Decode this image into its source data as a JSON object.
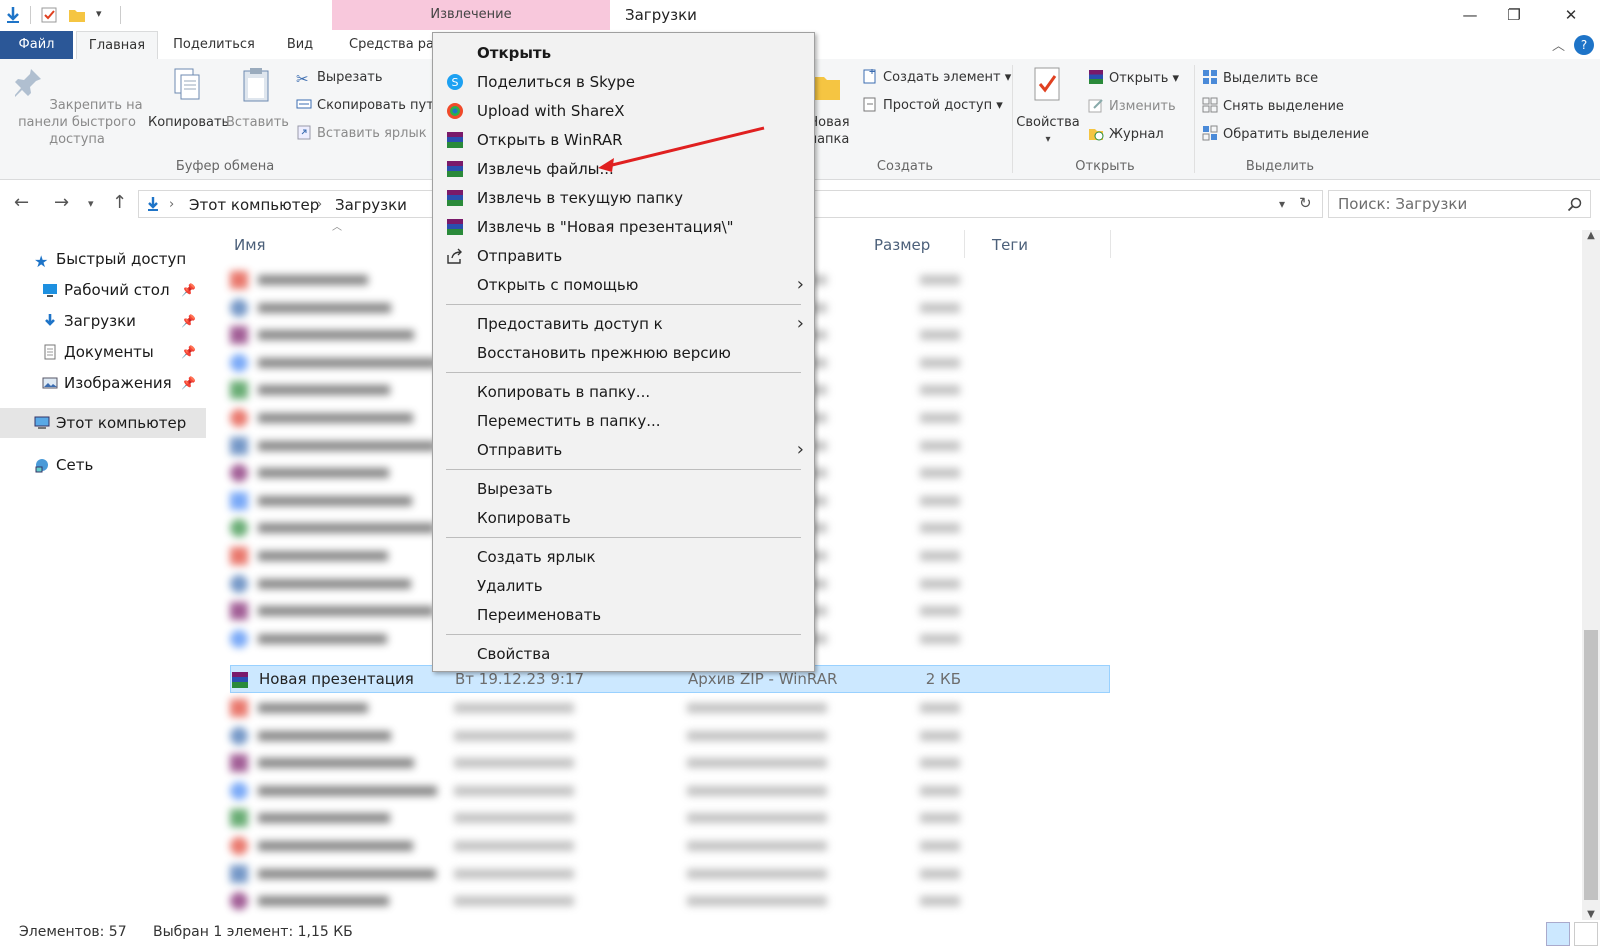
{
  "window": {
    "context_tab_label": "Извлечение",
    "title": "Загрузки",
    "minimize": "—",
    "restore": "❐",
    "close": "✕"
  },
  "ribbon_tabs": {
    "file": "Файл",
    "home": "Главная",
    "share": "Поделиться",
    "view": "Вид",
    "tools": "Средства раб"
  },
  "ribbon": {
    "pin_label": "Закрепить на панели быстрого доступа",
    "copy_label": "Копировать",
    "paste_label": "Вставить",
    "cut_label": "Вырезать",
    "copy_path_label": "Скопировать путь",
    "paste_shortcut_label": "Вставить ярлык",
    "clipboard_group": "Буфер обмена",
    "new_folder_partial": "Новая папка",
    "new_item_label": "Создать элемент ▾",
    "easy_access_label": "Простой доступ ▾",
    "create_group": "Создать",
    "properties_label": "Свойства",
    "open_label": "Открыть ▾",
    "edit_label": "Изменить",
    "history_label": "Журнал",
    "open_group": "Открыть",
    "select_all_label": "Выделить все",
    "select_none_label": "Снять выделение",
    "invert_selection_label": "Обратить выделение",
    "select_group": "Выделить"
  },
  "address": {
    "segments": [
      "Этот компьютер",
      "Загрузки"
    ],
    "search_placeholder": "Поиск: Загрузки"
  },
  "navpane": {
    "quick_access": "Быстрый доступ",
    "desktop": "Рабочий стол",
    "downloads": "Загрузки",
    "documents": "Документы",
    "pictures": "Изображения",
    "this_pc": "Этот компьютер",
    "network": "Сеть"
  },
  "columns": {
    "name": "Имя",
    "size": "Размер",
    "tags": "Теги"
  },
  "selected_row": {
    "name": "Новая презентация",
    "date": "Вт 19.12.23 9:17",
    "type": "Архив ZIP - WinRAR",
    "size": "2 КБ"
  },
  "status": {
    "count": "Элементов: 57",
    "selection": "Выбран 1 элемент: 1,15 КБ"
  },
  "context_menu": {
    "open": "Открыть",
    "skype": "Поделиться в Skype",
    "sharex": "Upload with ShareX",
    "winrar_open": "Открыть в WinRAR",
    "extract_files": "Извлечь файлы...",
    "extract_here": "Извлечь в текущую папку",
    "extract_to": "Извлечь в \"Новая презентация\\\"",
    "send": "Отправить",
    "open_with": "Открыть с помощью",
    "grant_access": "Предоставить доступ к",
    "restore_version": "Восстановить прежнюю версию",
    "copy_to": "Копировать в папку...",
    "move_to": "Переместить в папку...",
    "send_to": "Отправить",
    "cut": "Вырезать",
    "copy": "Копировать",
    "create_shortcut": "Создать ярлык",
    "delete": "Удалить",
    "rename": "Переименовать",
    "properties": "Свойства"
  },
  "colors": {
    "file_tab": "#2b5797",
    "context_tab": "#f8c8dc",
    "selection": "#cce8ff",
    "annotation_arrow": "#e02020"
  }
}
